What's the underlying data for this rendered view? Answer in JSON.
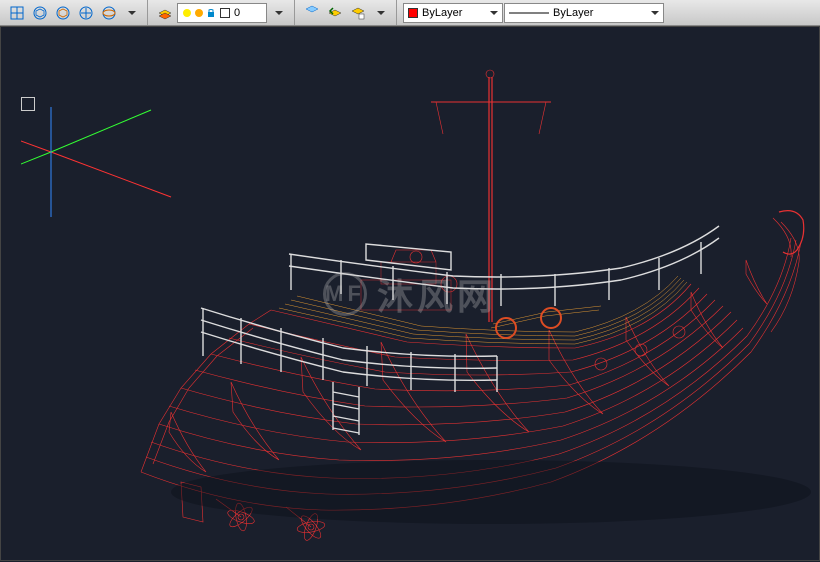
{
  "toolbar": {
    "layer": {
      "current_name": "0",
      "current_color": "#ffffff"
    },
    "properties": {
      "color_label": "ByLayer",
      "color_swatch": "#ff0000",
      "linetype_label": "ByLayer"
    }
  },
  "viewport": {
    "background": "#1a1f2c",
    "ucs": {
      "x_axis_color": "#ff3333",
      "y_axis_color": "#33ff33",
      "z_axis_color": "#3388ff"
    },
    "model": {
      "description": "boat-wireframe-3d",
      "primary_color": "#ff3333",
      "secondary_color": "#ffaa33",
      "rail_color": "#e8e8e8"
    }
  },
  "watermark": {
    "text": "沐风网",
    "logo_text": "MF"
  }
}
